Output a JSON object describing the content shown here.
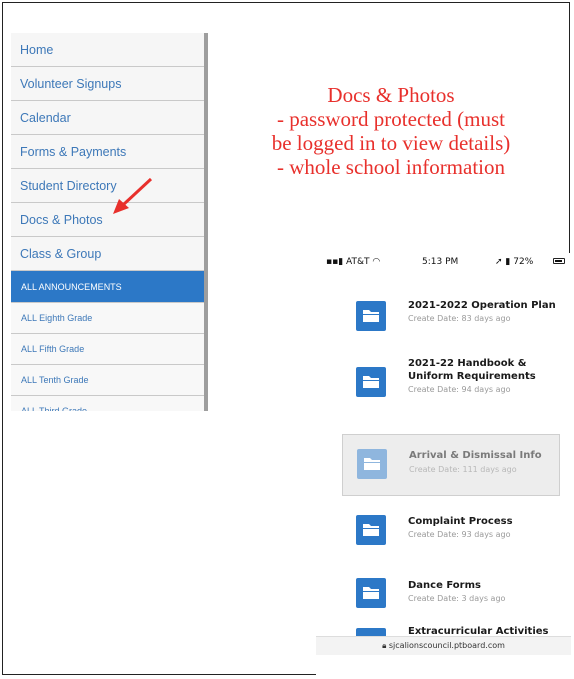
{
  "sidebar": {
    "items": [
      {
        "label": "Home"
      },
      {
        "label": "Volunteer Signups"
      },
      {
        "label": "Calendar"
      },
      {
        "label": "Forms & Payments"
      },
      {
        "label": "Student Directory"
      },
      {
        "label": "Docs & Photos"
      },
      {
        "label": "Class & Group"
      }
    ],
    "sub_items": [
      {
        "label": "ALL ANNOUNCEMENTS",
        "active": true
      },
      {
        "label": "ALL Eighth Grade",
        "active": false
      },
      {
        "label": "ALL Fifth Grade",
        "active": false
      },
      {
        "label": "ALL Tenth Grade",
        "active": false
      },
      {
        "label": "ALL Third Grade",
        "active": false
      }
    ]
  },
  "annotation": {
    "lines": [
      "Docs & Photos",
      "- password protected (must",
      "be logged in to view details)",
      "- whole school information"
    ],
    "color": "#e8302c"
  },
  "phone": {
    "status": {
      "carrier": "AT&T",
      "time": "5:13 PM",
      "battery": "72%"
    },
    "documents": [
      {
        "title": "2021-2022 Operation Plan",
        "date": "Create Date: 83 days ago"
      },
      {
        "title": "2021-22 Handbook & Uniform Requirements",
        "date": "Create Date: 94 days ago"
      },
      {
        "title": "Arrival & Dismissal Info",
        "date": "Create Date: 111 days ago"
      },
      {
        "title": "Complaint Process",
        "date": "Create Date: 93 days ago"
      },
      {
        "title": "Dance Forms",
        "date": "Create Date: 3 days ago"
      },
      {
        "title": "Extracurricular Activities",
        "date": ""
      }
    ],
    "url": "sjcalionscouncil.ptboard.com"
  },
  "colors": {
    "accent": "#2c78c7",
    "link": "#3d78b8"
  }
}
